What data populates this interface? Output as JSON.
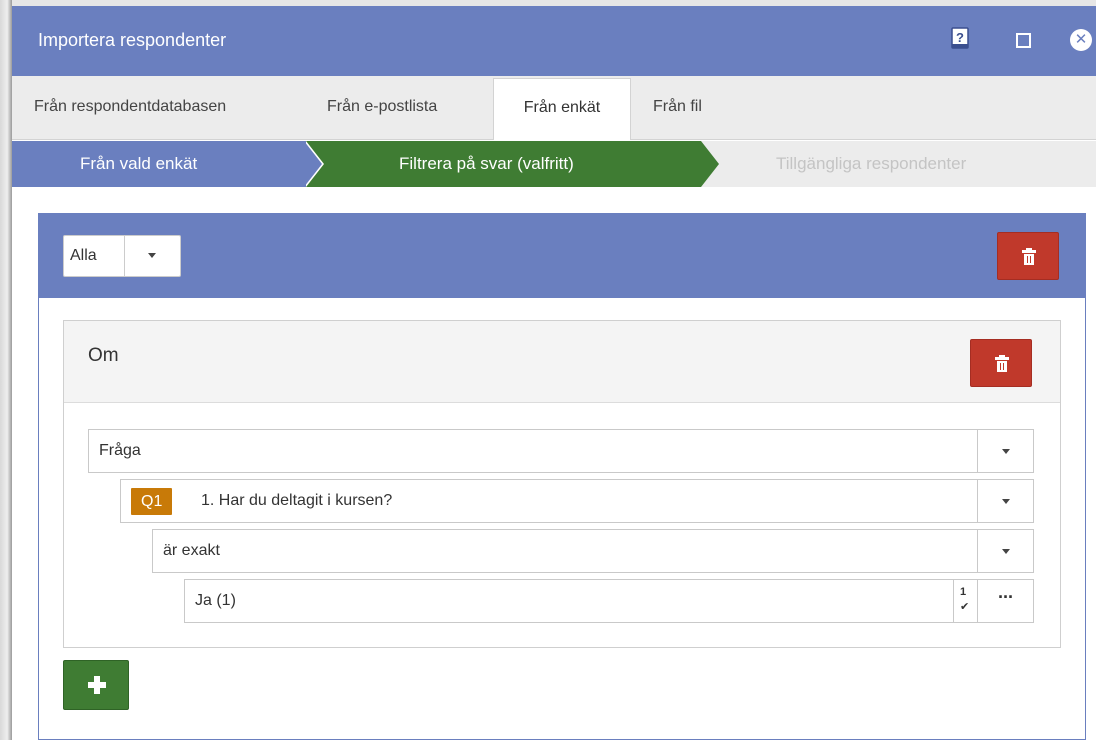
{
  "window": {
    "title": "Importera respondenter",
    "icons": {
      "help": "help-icon",
      "maximize": "maximize-icon",
      "close": "close-icon"
    }
  },
  "tabs": [
    {
      "label": "Från respondentdatabasen",
      "active": false
    },
    {
      "label": "Från e-postlista",
      "active": false
    },
    {
      "label": "Från enkät",
      "active": true
    },
    {
      "label": "Från fil",
      "active": false
    }
  ],
  "wizard": {
    "steps": [
      {
        "label": "Från vald enkät",
        "state": "done"
      },
      {
        "label": "Filtrera på svar (valfritt)",
        "state": "current"
      },
      {
        "label": "Tillgängliga respondenter",
        "state": "disabled"
      }
    ]
  },
  "filter_group": {
    "match_mode": "Alla",
    "delete_icon": "trash-icon"
  },
  "condition": {
    "heading": "Om",
    "source_type": "Fråga",
    "question_badge": "Q1",
    "question_text": "1. Har du deltagit i kursen?",
    "operator": "är exakt",
    "value": "Ja (1)",
    "numeric_icon": {
      "top": "1",
      "bottom": "✔"
    },
    "more_label": "···"
  },
  "add_button_icon": "plus-icon",
  "colors": {
    "header_blue": "#6a7fbf",
    "step_green": "#3f7c33",
    "delete_red": "#c0392b",
    "badge_orange": "#c87a08"
  }
}
